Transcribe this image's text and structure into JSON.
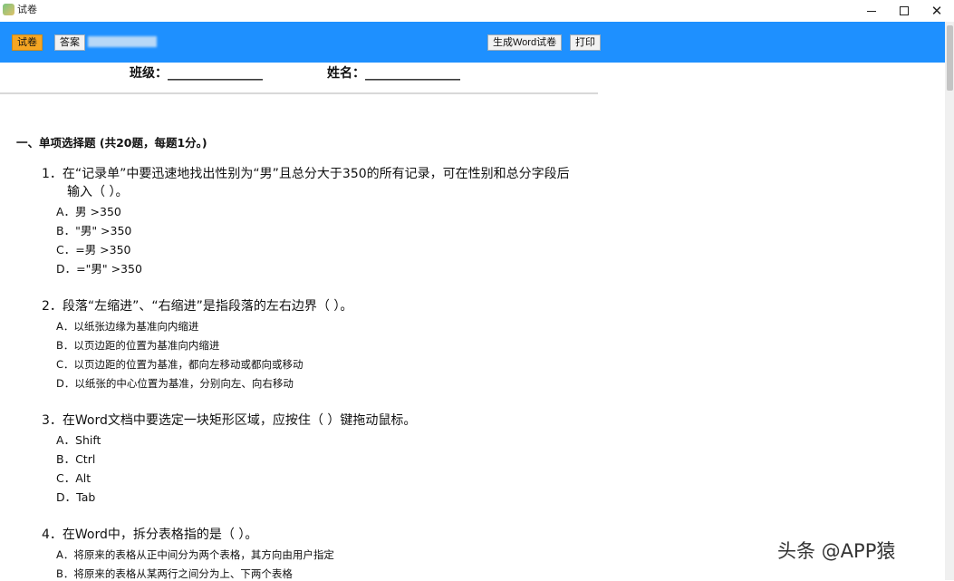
{
  "window": {
    "title": "试卷"
  },
  "toolbar": {
    "exam_label": "试卷",
    "answer_label": "答案",
    "generate_word_label": "生成Word试卷",
    "print_label": "打印"
  },
  "header": {
    "class_label": "班级：_______________",
    "name_label": "姓名：_______________"
  },
  "section": {
    "title": "一、单项选择题 (共20题，每题1分。)"
  },
  "questions": [
    {
      "line1": "1．在“记录单”中要迅速地找出性别为“男”且总分大于350的所有记录，可在性别和总分字段后",
      "line2": "输入（ ）。",
      "options": [
        "A．男 >350",
        "B．\"男\" >350",
        "C．=男 >350",
        "D．=\"男\" >350"
      ]
    },
    {
      "line1": "2．段落“左缩进”、“右缩进”是指段落的左右边界（ ）。",
      "options": [
        "A．以纸张边缘为基准向内缩进",
        "B．以页边距的位置为基准向内缩进",
        "C．以页边距的位置为基准，都向左移动或都向或移动",
        "D．以纸张的中心位置为基准，分别向左、向右移动"
      ]
    },
    {
      "line1": "3．在Word文档中要选定一块矩形区域，应按住（ ）键拖动鼠标。",
      "options": [
        "A．Shift",
        "B．Ctrl",
        "C．Alt",
        "D．Tab"
      ]
    },
    {
      "line1": "4．在Word中，拆分表格指的是（ ）。",
      "options": [
        "A．将原来的表格从正中间分为两个表格，其方向由用户指定",
        "B．将原来的表格从某两行之间分为上、下两个表格"
      ]
    }
  ],
  "watermark": "头条 @APP猿"
}
